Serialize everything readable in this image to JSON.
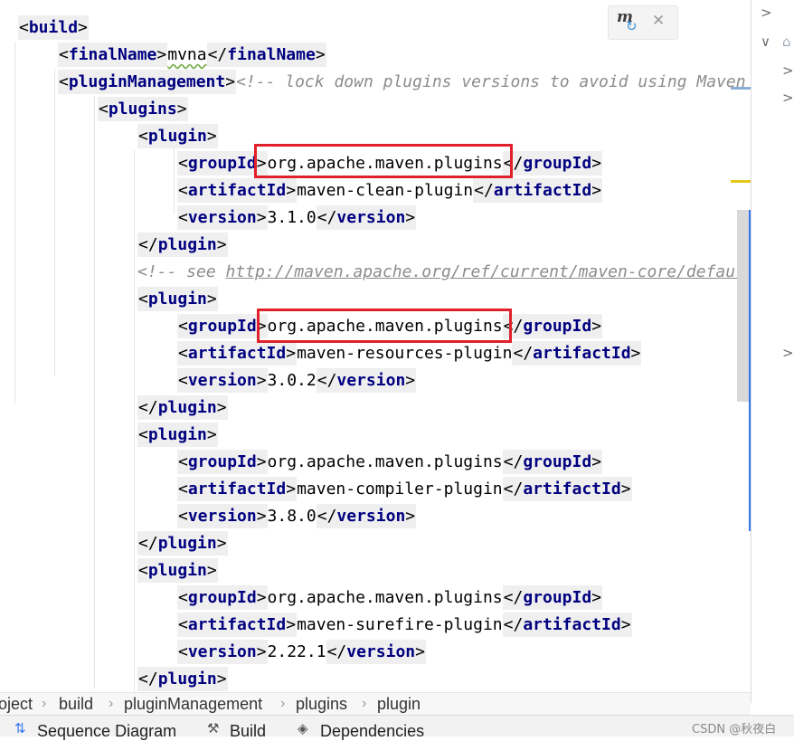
{
  "editor": {
    "lines": [
      {
        "parts": [
          {
            "t": "<",
            "k": "br"
          },
          {
            "t": "build",
            "k": "tag"
          },
          {
            "t": ">",
            "k": "br"
          }
        ]
      },
      {
        "parts": [
          {
            "t": "<",
            "k": "br"
          },
          {
            "t": "finalName",
            "k": "tag"
          },
          {
            "t": ">",
            "k": "br"
          },
          {
            "t": "mvna",
            "k": "txt"
          },
          {
            "t": "</",
            "k": "br"
          },
          {
            "t": "finalName",
            "k": "tag"
          },
          {
            "t": ">",
            "k": "br"
          }
        ]
      },
      {
        "parts": [
          {
            "t": "<",
            "k": "br"
          },
          {
            "t": "pluginManagement",
            "k": "tag"
          },
          {
            "t": ">",
            "k": "br"
          },
          {
            "t": "<!-- lock down plugins versions to avoid using Maven",
            "k": "comment"
          }
        ]
      },
      {
        "parts": [
          {
            "t": "<",
            "k": "br"
          },
          {
            "t": "plugins",
            "k": "tag"
          },
          {
            "t": ">",
            "k": "br"
          }
        ]
      },
      {
        "parts": [
          {
            "t": "<",
            "k": "br"
          },
          {
            "t": "plugin",
            "k": "tag"
          },
          {
            "t": ">",
            "k": "br"
          }
        ]
      },
      {
        "parts": [
          {
            "t": "<",
            "k": "br"
          },
          {
            "t": "groupId",
            "k": "tag"
          },
          {
            "t": ">",
            "k": "br"
          },
          {
            "t": "org.apache.maven.plugins",
            "k": "txt"
          },
          {
            "t": "</",
            "k": "br"
          },
          {
            "t": "groupId",
            "k": "tag"
          },
          {
            "t": ">",
            "k": "br"
          }
        ]
      },
      {
        "parts": [
          {
            "t": "<",
            "k": "br"
          },
          {
            "t": "artifactId",
            "k": "tag"
          },
          {
            "t": ">",
            "k": "br"
          },
          {
            "t": "maven-clean-plugin",
            "k": "txt"
          },
          {
            "t": "</",
            "k": "br"
          },
          {
            "t": "artifactId",
            "k": "tag"
          },
          {
            "t": ">",
            "k": "br"
          }
        ]
      },
      {
        "parts": [
          {
            "t": "<",
            "k": "br"
          },
          {
            "t": "version",
            "k": "tag"
          },
          {
            "t": ">",
            "k": "br"
          },
          {
            "t": "3.1.0",
            "k": "txt"
          },
          {
            "t": "</",
            "k": "br"
          },
          {
            "t": "version",
            "k": "tag"
          },
          {
            "t": ">",
            "k": "br"
          }
        ]
      },
      {
        "parts": [
          {
            "t": "</",
            "k": "br"
          },
          {
            "t": "plugin",
            "k": "tag"
          },
          {
            "t": ">",
            "k": "br"
          }
        ]
      },
      {
        "parts": [
          {
            "t": "<!-- see ",
            "k": "comment"
          },
          {
            "t": "http://maven.apache.org/ref/current/maven-core/defaul",
            "k": "link"
          }
        ]
      },
      {
        "parts": [
          {
            "t": "<",
            "k": "br"
          },
          {
            "t": "plugin",
            "k": "tag"
          },
          {
            "t": ">",
            "k": "br"
          }
        ]
      },
      {
        "parts": [
          {
            "t": "<",
            "k": "br"
          },
          {
            "t": "groupId",
            "k": "tag"
          },
          {
            "t": ">",
            "k": "br"
          },
          {
            "t": "org.apache.maven.plugins",
            "k": "txt"
          },
          {
            "t": "</",
            "k": "br"
          },
          {
            "t": "groupId",
            "k": "tag"
          },
          {
            "t": ">",
            "k": "br"
          }
        ]
      },
      {
        "parts": [
          {
            "t": "<",
            "k": "br"
          },
          {
            "t": "artifactId",
            "k": "tag"
          },
          {
            "t": ">",
            "k": "br"
          },
          {
            "t": "maven-resources-plugin",
            "k": "txt"
          },
          {
            "t": "</",
            "k": "br"
          },
          {
            "t": "artifactId",
            "k": "tag"
          },
          {
            "t": ">",
            "k": "br"
          }
        ]
      },
      {
        "parts": [
          {
            "t": "<",
            "k": "br"
          },
          {
            "t": "version",
            "k": "tag"
          },
          {
            "t": ">",
            "k": "br"
          },
          {
            "t": "3.0.2",
            "k": "txt"
          },
          {
            "t": "</",
            "k": "br"
          },
          {
            "t": "version",
            "k": "tag"
          },
          {
            "t": ">",
            "k": "br"
          }
        ]
      },
      {
        "parts": [
          {
            "t": "</",
            "k": "br"
          },
          {
            "t": "plugin",
            "k": "tag"
          },
          {
            "t": ">",
            "k": "br"
          }
        ]
      },
      {
        "parts": [
          {
            "t": "<",
            "k": "br"
          },
          {
            "t": "plugin",
            "k": "tag"
          },
          {
            "t": ">",
            "k": "br"
          }
        ]
      },
      {
        "parts": [
          {
            "t": "<",
            "k": "br"
          },
          {
            "t": "groupId",
            "k": "tag"
          },
          {
            "t": ">",
            "k": "br"
          },
          {
            "t": "org.apache.maven.plugins",
            "k": "txt"
          },
          {
            "t": "</",
            "k": "br"
          },
          {
            "t": "groupId",
            "k": "tag"
          },
          {
            "t": ">",
            "k": "br"
          }
        ]
      },
      {
        "parts": [
          {
            "t": "<",
            "k": "br"
          },
          {
            "t": "artifactId",
            "k": "tag"
          },
          {
            "t": ">",
            "k": "br"
          },
          {
            "t": "maven-compiler-plugin",
            "k": "txt"
          },
          {
            "t": "</",
            "k": "br"
          },
          {
            "t": "artifactId",
            "k": "tag"
          },
          {
            "t": ">",
            "k": "br"
          }
        ]
      },
      {
        "parts": [
          {
            "t": "<",
            "k": "br"
          },
          {
            "t": "version",
            "k": "tag"
          },
          {
            "t": ">",
            "k": "br"
          },
          {
            "t": "3.8.0",
            "k": "txt"
          },
          {
            "t": "</",
            "k": "br"
          },
          {
            "t": "version",
            "k": "tag"
          },
          {
            "t": ">",
            "k": "br"
          }
        ]
      },
      {
        "parts": [
          {
            "t": "</",
            "k": "br"
          },
          {
            "t": "plugin",
            "k": "tag"
          },
          {
            "t": ">",
            "k": "br"
          }
        ]
      },
      {
        "parts": [
          {
            "t": "<",
            "k": "br"
          },
          {
            "t": "plugin",
            "k": "tag"
          },
          {
            "t": ">",
            "k": "br"
          }
        ]
      },
      {
        "parts": [
          {
            "t": "<",
            "k": "br"
          },
          {
            "t": "groupId",
            "k": "tag"
          },
          {
            "t": ">",
            "k": "br"
          },
          {
            "t": "org.apache.maven.plugins",
            "k": "txt"
          },
          {
            "t": "</",
            "k": "br"
          },
          {
            "t": "groupId",
            "k": "tag"
          },
          {
            "t": ">",
            "k": "br"
          }
        ]
      },
      {
        "parts": [
          {
            "t": "<",
            "k": "br"
          },
          {
            "t": "artifactId",
            "k": "tag"
          },
          {
            "t": ">",
            "k": "br"
          },
          {
            "t": "maven-surefire-plugin",
            "k": "txt"
          },
          {
            "t": "</",
            "k": "br"
          },
          {
            "t": "artifactId",
            "k": "tag"
          },
          {
            "t": ">",
            "k": "br"
          }
        ]
      },
      {
        "parts": [
          {
            "t": "<",
            "k": "br"
          },
          {
            "t": "version",
            "k": "tag"
          },
          {
            "t": ">",
            "k": "br"
          },
          {
            "t": "2.22.1",
            "k": "txt"
          },
          {
            "t": "</",
            "k": "br"
          },
          {
            "t": "version",
            "k": "tag"
          },
          {
            "t": ">",
            "k": "br"
          }
        ]
      },
      {
        "parts": [
          {
            "t": "</",
            "k": "br"
          },
          {
            "t": "plugin",
            "k": "tag"
          },
          {
            "t": ">",
            "k": "br"
          }
        ]
      }
    ]
  },
  "maven_popup": {
    "icon": "maven-m-icon",
    "refresh_icon": "refresh-icon",
    "m_glyph": "m",
    "refresh_glyph": "↻",
    "close_glyph": "✕"
  },
  "breadcrumb": {
    "items": [
      "oject",
      "build",
      "pluginManagement",
      "plugins",
      "plugin"
    ],
    "separator": "›"
  },
  "tool_windows": {
    "items": [
      {
        "label": "Sequence Diagram",
        "icon": "sequence-diagram-icon",
        "glyph": "⇅"
      },
      {
        "label": "Build",
        "icon": "hammer-icon",
        "glyph": "⚒"
      },
      {
        "label": "Dependencies",
        "icon": "layers-icon",
        "glyph": "◈"
      }
    ],
    "watermark": "CSDN @秋夜白"
  },
  "right_panel": {
    "glyphs": [
      ">",
      "∨",
      "⌂",
      ">",
      ">",
      ">"
    ]
  },
  "colors": {
    "tag": "#000080",
    "comment": "#8c8c8c",
    "highlight_box": "#e0202a",
    "tag_background": "#efefef"
  }
}
